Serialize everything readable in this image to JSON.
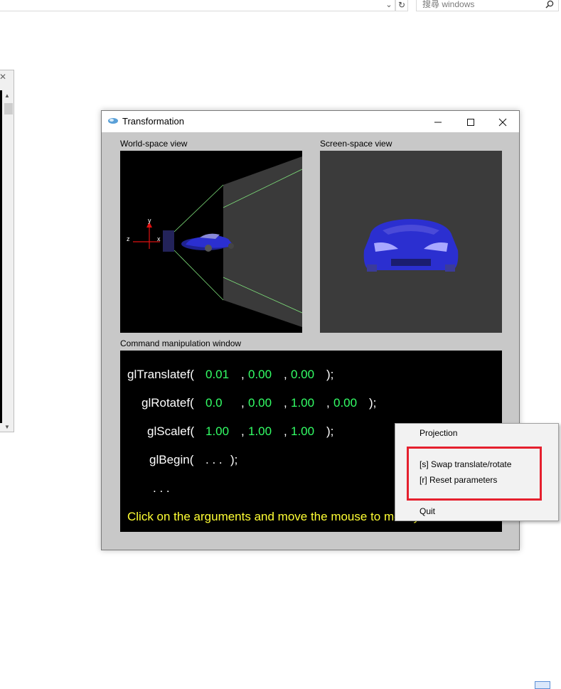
{
  "browser": {
    "search_placeholder": "搜尋 windows"
  },
  "window": {
    "title": "Transformation",
    "controls": {
      "minimize": "—",
      "maximize": "☐",
      "close": "✕"
    }
  },
  "panes": {
    "world_label": "World-space view",
    "screen_label": "Screen-space view",
    "command_label": "Command manipulation window"
  },
  "axes": {
    "y": "y",
    "z": "z",
    "x": "x"
  },
  "commands": {
    "translate": {
      "fn": "glTranslatef(",
      "a1": "0.01",
      "a2": "0.00",
      "a3": "0.00",
      "close": ");"
    },
    "rotate": {
      "fn": "glRotatef(",
      "a1": "0.0",
      "a2": "0.00",
      "a3": "1.00",
      "a4": "0.00",
      "close": ");"
    },
    "scale": {
      "fn": "glScalef(",
      "a1": "1.00",
      "a2": "1.00",
      "a3": "1.00",
      "close": ");"
    },
    "begin": {
      "fn": "glBegin(",
      "args": ". . .",
      "close": ");"
    },
    "ellipsis": ". . .",
    "separator": ",",
    "hint": "Click on the arguments and move the mouse to modify values."
  },
  "context_menu": {
    "projection": "Projection",
    "swap": "[s]  Swap translate/rotate",
    "reset": "[r]  Reset parameters",
    "quit": "Quit"
  },
  "colors": {
    "argument": "#33ff66",
    "hint": "#ffff33",
    "highlight": "#e5202e",
    "car": "#2b2fd0"
  }
}
